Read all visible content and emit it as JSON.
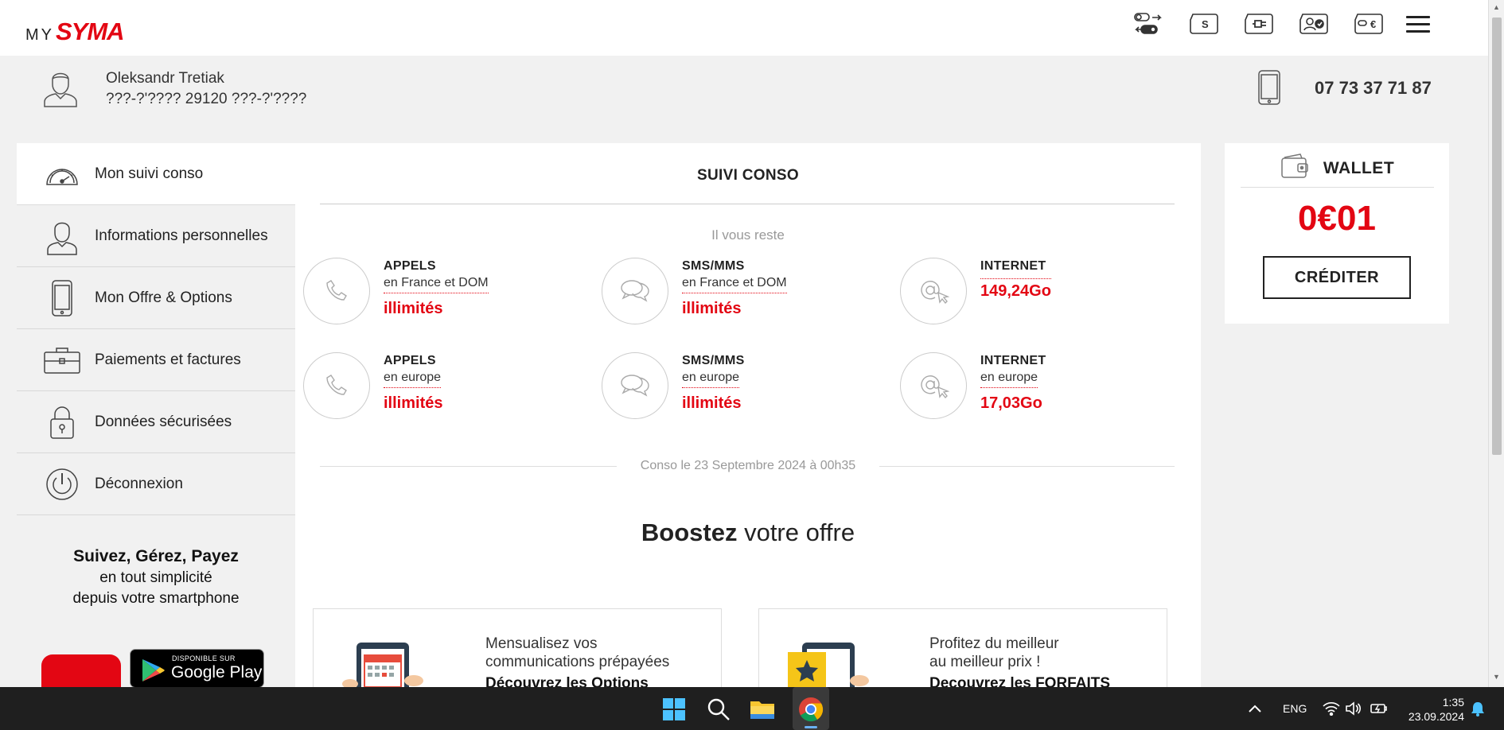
{
  "brand": {
    "my": "MY",
    "syma": "SYMA"
  },
  "top_icons": [
    "switch-toggle-icon",
    "sim-card-icon",
    "plug-recharge-icon",
    "account-check-icon",
    "wallet-euro-icon"
  ],
  "user": {
    "name": "Oleksandr Tretiak",
    "address": "???-?'???? 29120 ???-?'????",
    "phone": "07 73 37 71 87"
  },
  "sidebar": {
    "items": [
      {
        "label": "Mon suivi conso",
        "icon": "speedometer-icon",
        "active": true
      },
      {
        "label": "Informations personnelles",
        "icon": "user-icon"
      },
      {
        "label": "Mon Offre & Options",
        "icon": "smartphone-icon"
      },
      {
        "label": "Paiements et factures",
        "icon": "briefcase-icon"
      },
      {
        "label": "Données sécurisées",
        "icon": "padlock-icon"
      },
      {
        "label": "Déconnexion",
        "icon": "power-icon"
      }
    ],
    "promo": {
      "line1": "Suivez, Gérez, Payez",
      "line2": "en tout simplicité",
      "line3": "depuis votre smartphone"
    },
    "google_play": {
      "small": "DISPONIBLE SUR",
      "big": "Google Play"
    }
  },
  "main": {
    "title": "SUIVI CONSO",
    "subtitle": "Il vous reste",
    "conso": [
      {
        "category": "APPELS",
        "zone": "en France et DOM",
        "value": "illimités",
        "icon": "phone-handset-icon"
      },
      {
        "category": "SMS/MMS",
        "zone": "en France et DOM",
        "value": "illimités",
        "icon": "chat-bubbles-icon"
      },
      {
        "category": "INTERNET",
        "zone": "",
        "value": "149,24Go",
        "icon": "at-cursor-icon"
      },
      {
        "category": "APPELS",
        "zone": "en europe",
        "value": "illimités",
        "icon": "phone-handset-icon"
      },
      {
        "category": "SMS/MMS",
        "zone": "en europe",
        "value": "illimités",
        "icon": "chat-bubbles-icon"
      },
      {
        "category": "INTERNET",
        "zone": "en europe",
        "value": "17,03Go",
        "icon": "at-cursor-icon"
      }
    ],
    "date": "Conso le 23 Septembre 2024 à 00h35",
    "boost": {
      "bold": "Boostez",
      "rest": " votre offre"
    },
    "offers": [
      {
        "line1": "Mensualisez vos",
        "line2": "communications prépayées",
        "cta": "Découvrez les Options"
      },
      {
        "line1": "Profitez du meilleur",
        "line2": "au meilleur prix !",
        "cta": "Decouvrez les FORFAITS"
      }
    ]
  },
  "wallet": {
    "title": "WALLET",
    "amount": "0€01",
    "button": "CRÉDITER"
  },
  "taskbar": {
    "lang": "ENG",
    "time": "1:35",
    "date": "23.09.2024"
  },
  "colors": {
    "accent": "#e30613",
    "text": "#222222",
    "background": "#f1f1f1"
  }
}
